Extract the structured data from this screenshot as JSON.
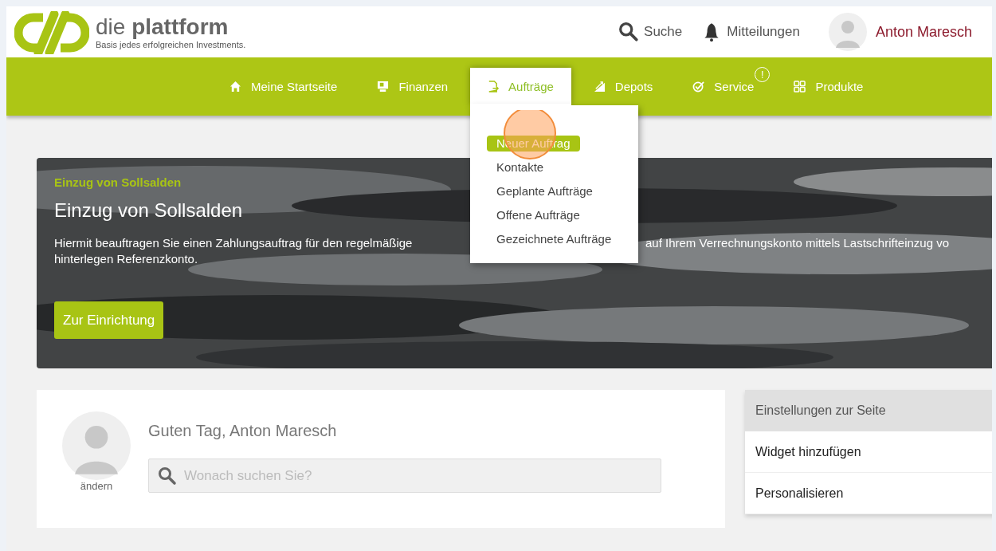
{
  "header": {
    "logo": {
      "title": "die **plattform**",
      "tagline": "Basis jedes erfolgreichen Investments."
    },
    "actions": [
      {
        "kind": "search",
        "label": "Suche"
      },
      {
        "kind": "notifications",
        "label": "Mitteilungen"
      }
    ],
    "user": {
      "name": "Anton Maresch"
    }
  },
  "nav": {
    "items": [
      {
        "label": "Meine Startseite",
        "selected": false
      },
      {
        "label": "Finanzen",
        "selected": false
      },
      {
        "label": "Aufträge",
        "selected": true
      },
      {
        "label": "Depots",
        "selected": false
      },
      {
        "label": "Service",
        "selected": false,
        "badge": "!"
      },
      {
        "label": "Produkte",
        "selected": false
      }
    ]
  },
  "dropdown": {
    "items": [
      {
        "label": "Neuer Auftrag",
        "selected": true
      },
      {
        "label": "Kontakte",
        "selected": false
      },
      {
        "label": "Geplante Aufträge",
        "selected": false
      },
      {
        "label": "Offene Aufträge",
        "selected": false
      },
      {
        "label": "Gezeichnete Aufträge",
        "selected": false
      }
    ]
  },
  "banner": {
    "kind": "picture",
    "eyebrow": "Einzug von Sollsalden",
    "title": "Einzug von Sollsalden",
    "description": {
      "line_1_left": "Hiermit beauftragen Sie einen Zahlungsauftrag für den regelmäßige",
      "line_1_right": "auf Ihrem Verrechnungskonto mittels Lastschrifteinzug vo",
      "line_2": "hinterlegen Referenzkonto."
    },
    "button": "Zur Einrichtung"
  },
  "welcome": {
    "avatar_caption": "ändern",
    "greeting": "Guten Tag, Anton Maresch",
    "search": {
      "placeholder": "Wonach suchen Sie?"
    }
  },
  "settings": {
    "title": "Einstellungen zur Seite",
    "items": [
      "Widget hinzufügen",
      "Personalisieren"
    ]
  }
}
